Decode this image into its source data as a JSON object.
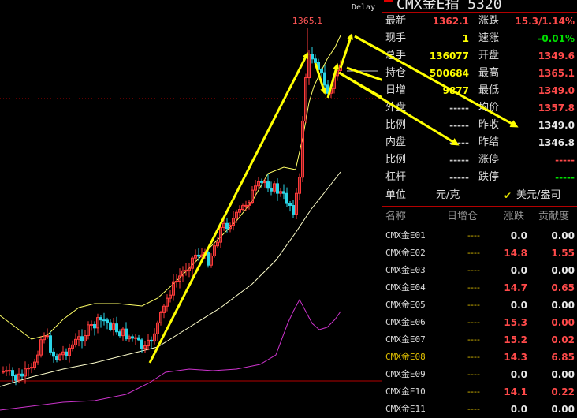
{
  "chart": {
    "delay_label": "Delay",
    "peak_label": "1365.1"
  },
  "colors": {
    "background": "#000000",
    "up": "#ff3b3b",
    "down": "#2ad4e6",
    "ma_short": "#ffff66",
    "ma_long": "#ffffcc",
    "indicator": "#cc33cc",
    "arrow": "#ffff00",
    "grid": "#b40000"
  },
  "panel": {
    "title": "CMX金E指 5320",
    "quote_left": [
      {
        "label": "最新",
        "value": "1362.1",
        "color": "red"
      },
      {
        "label": "现手",
        "value": "1",
        "color": "yellow"
      },
      {
        "label": "总手",
        "value": "136077",
        "color": "yellow"
      },
      {
        "label": "持仓",
        "value": "500684",
        "color": "yellow"
      },
      {
        "label": "日增",
        "value": "9877",
        "color": "yellow"
      },
      {
        "label": "外盘",
        "value": "-----",
        "color": "dim"
      },
      {
        "label": "比例",
        "value": "-----",
        "color": "dim"
      },
      {
        "label": "内盘",
        "value": "-----",
        "color": "dim"
      },
      {
        "label": "比例",
        "value": "-----",
        "color": "dim"
      },
      {
        "label": "杠杆",
        "value": "-----",
        "color": "dim"
      }
    ],
    "quote_right": [
      {
        "label": "涨跌",
        "value": "15.3/1.14%",
        "color": "red"
      },
      {
        "label": "速涨",
        "value": "-0.01%",
        "color": "green"
      },
      {
        "label": "开盘",
        "value": "1349.6",
        "color": "red"
      },
      {
        "label": "最高",
        "value": "1365.1",
        "color": "red"
      },
      {
        "label": "最低",
        "value": "1349.0",
        "color": "red"
      },
      {
        "label": "均价",
        "value": "1357.8",
        "color": "red"
      },
      {
        "label": "昨收",
        "value": "1349.0",
        "color": "white"
      },
      {
        "label": "昨结",
        "value": "1346.8",
        "color": "white"
      },
      {
        "label": "涨停",
        "value": "-----",
        "color": "red"
      },
      {
        "label": "跌停",
        "value": "-----",
        "color": "green"
      }
    ],
    "unit_label": "单位",
    "unit_value": "元/克",
    "currency_option": "美元/盎司",
    "table": {
      "headers": [
        "名称",
        "日增仓",
        "涨跌",
        "贡献度"
      ],
      "rows": [
        {
          "name": "CMX金E01",
          "inc": "----",
          "chg": "0.0",
          "con": "0.00",
          "chg_color": "white",
          "con_color": "white",
          "highlight": false
        },
        {
          "name": "CMX金E02",
          "inc": "----",
          "chg": "14.8",
          "con": "1.55",
          "chg_color": "red",
          "con_color": "red",
          "highlight": false
        },
        {
          "name": "CMX金E03",
          "inc": "----",
          "chg": "0.0",
          "con": "0.00",
          "chg_color": "white",
          "con_color": "white",
          "highlight": false
        },
        {
          "name": "CMX金E04",
          "inc": "----",
          "chg": "14.7",
          "con": "0.65",
          "chg_color": "red",
          "con_color": "red",
          "highlight": false
        },
        {
          "name": "CMX金E05",
          "inc": "----",
          "chg": "0.0",
          "con": "0.00",
          "chg_color": "white",
          "con_color": "white",
          "highlight": false
        },
        {
          "name": "CMX金E06",
          "inc": "----",
          "chg": "15.3",
          "con": "0.00",
          "chg_color": "red",
          "con_color": "red",
          "highlight": false
        },
        {
          "name": "CMX金E07",
          "inc": "----",
          "chg": "15.2",
          "con": "0.02",
          "chg_color": "red",
          "con_color": "red",
          "highlight": false
        },
        {
          "name": "CMX金E08",
          "inc": "----",
          "chg": "14.3",
          "con": "6.85",
          "chg_color": "red",
          "con_color": "red",
          "highlight": true
        },
        {
          "name": "CMX金E09",
          "inc": "----",
          "chg": "0.0",
          "con": "0.00",
          "chg_color": "white",
          "con_color": "white",
          "highlight": false
        },
        {
          "name": "CMX金E10",
          "inc": "----",
          "chg": "14.1",
          "con": "0.22",
          "chg_color": "red",
          "con_color": "red",
          "highlight": false
        },
        {
          "name": "CMX金E11",
          "inc": "----",
          "chg": "0.0",
          "con": "0.00",
          "chg_color": "white",
          "con_color": "white",
          "highlight": false
        }
      ]
    }
  }
}
